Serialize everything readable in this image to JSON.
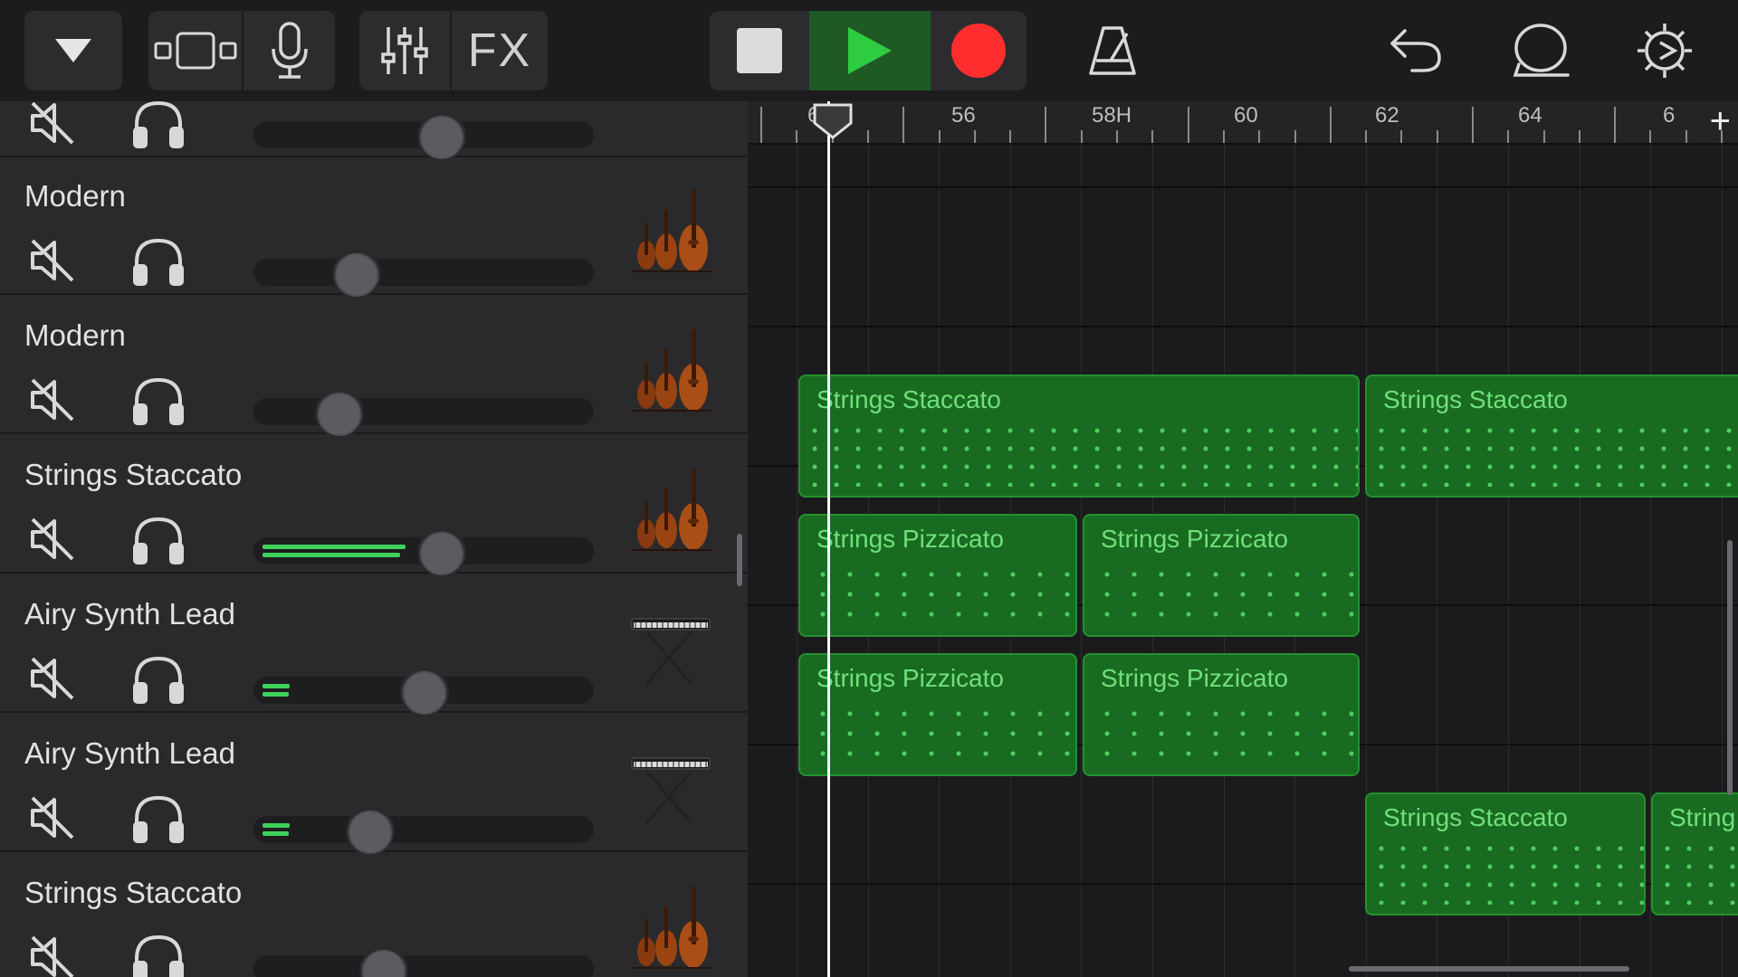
{
  "toolbar": {
    "fx_label": "FX",
    "icons": [
      "dropdown-triangle",
      "view-toggle",
      "microphone",
      "mixer-sliders",
      "stop-square",
      "play-triangle",
      "record-circle",
      "metronome",
      "undo-arrow",
      "loop-bubble",
      "settings-gear"
    ],
    "colors": {
      "play": "#2ecc40",
      "record": "#ff2d2d",
      "accent_green": "#1f5a25"
    }
  },
  "ruler": {
    "labels": [
      "64",
      "56",
      "58H",
      "60",
      "62",
      "64",
      "6"
    ]
  },
  "tracks": [
    {
      "name": "Modern",
      "instrument": "strings-icon",
      "volume": 0.3,
      "level": 0
    },
    {
      "name": "Modern",
      "instrument": "strings-icon",
      "volume": 0.25,
      "level": 0
    },
    {
      "name": "Strings Staccato",
      "instrument": "strings-icon",
      "volume": 0.55,
      "level": 0.42
    },
    {
      "name": "Airy Synth Lead",
      "instrument": "keyboard-icon",
      "volume": 0.5,
      "level": 0.08
    },
    {
      "name": "Airy Synth Lead",
      "instrument": "keyboard-icon",
      "volume": 0.34,
      "level": 0.08
    },
    {
      "name": "Strings Staccato",
      "instrument": "strings-icon",
      "volume": 0.38,
      "level": 0
    }
  ],
  "regions": [
    {
      "lane": 2,
      "label": "Strings Staccato"
    },
    {
      "lane": 2,
      "label": "Strings Staccato"
    },
    {
      "lane": 3,
      "label": "Strings Pizzicato"
    },
    {
      "lane": 3,
      "label": "Strings Pizzicato"
    },
    {
      "lane": 4,
      "label": "Strings Pizzicato"
    },
    {
      "lane": 4,
      "label": "Strings Pizzicato"
    },
    {
      "lane": 5,
      "label": "Strings Staccato"
    },
    {
      "lane": 5,
      "label": "String"
    }
  ]
}
